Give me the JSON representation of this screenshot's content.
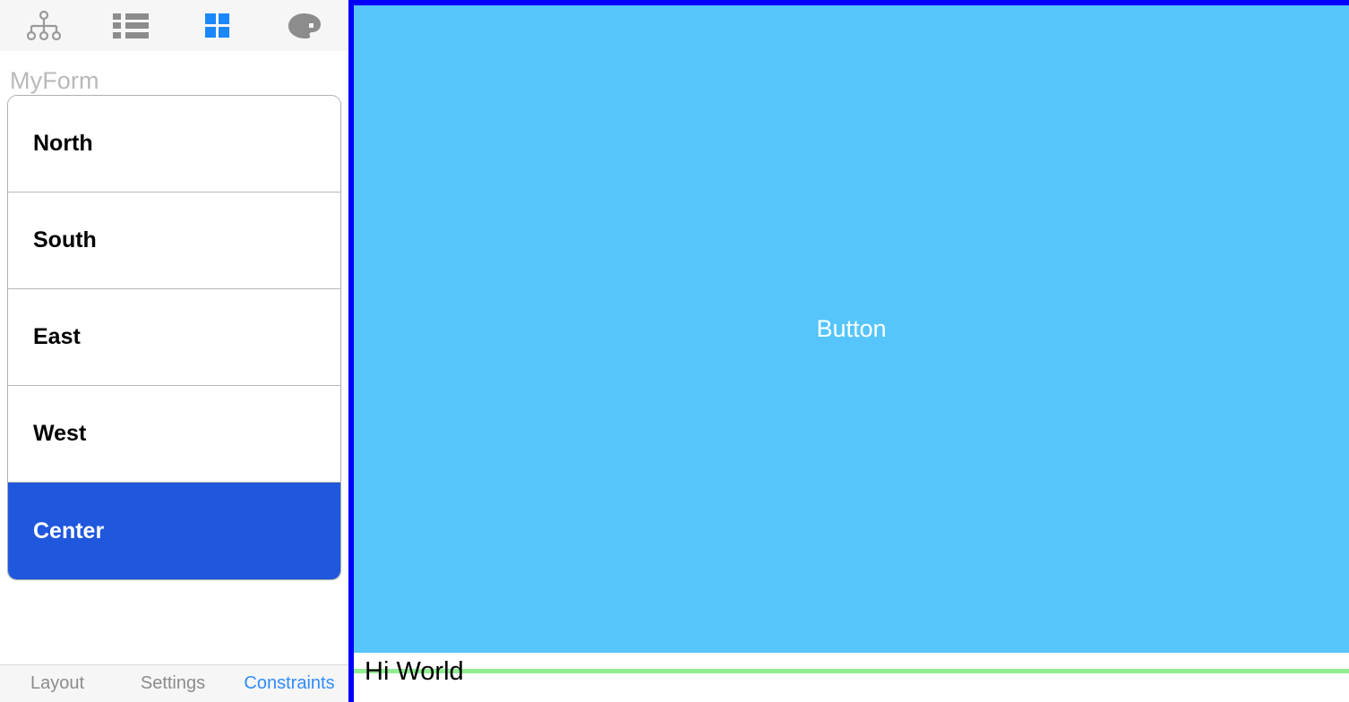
{
  "toolbar": {
    "buttons": [
      {
        "name": "tree-icon",
        "label": "Hierarchy",
        "active": false,
        "color": "#8c8c8c"
      },
      {
        "name": "list-icon",
        "label": "List",
        "active": false,
        "color": "#8c8c8c"
      },
      {
        "name": "grid-icon",
        "label": "Grid",
        "active": true,
        "color": "#1a87fb"
      },
      {
        "name": "palette-icon",
        "label": "Palette",
        "active": false,
        "color": "#8c8c8c"
      }
    ]
  },
  "sidebar": {
    "title": "MyForm",
    "items": [
      {
        "label": "North",
        "selected": false
      },
      {
        "label": "South",
        "selected": false
      },
      {
        "label": "East",
        "selected": false
      },
      {
        "label": "West",
        "selected": false
      },
      {
        "label": "Center",
        "selected": true
      }
    ],
    "selected_color": "#1f57dd"
  },
  "footer": {
    "tabs": [
      {
        "label": "Layout",
        "active": false
      },
      {
        "label": "Settings",
        "active": false
      },
      {
        "label": "Constraints",
        "active": true
      }
    ],
    "active_color": "#2f8bfb",
    "inactive_color": "#8b8b8b"
  },
  "canvas": {
    "selection_border_color": "#0000fb",
    "button": {
      "label": "Button",
      "background": "#55c5fc",
      "text_color": "#ffffff"
    },
    "label": {
      "text": "Hi World",
      "text_color": "#000000"
    },
    "guide_color": "#90ee90"
  }
}
